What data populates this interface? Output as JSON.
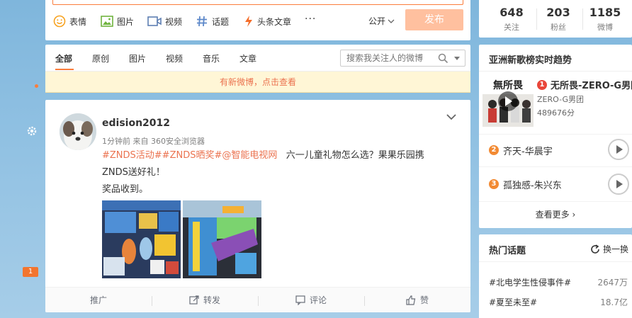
{
  "composer": {
    "tools": {
      "emoji": "表情",
      "picture": "图片",
      "video": "视频",
      "topic": "话题",
      "article": "头条文章",
      "more": "···"
    },
    "visibility": "公开",
    "publish_label": "发布",
    "accent_color": "#fa7d3c"
  },
  "feed_filters": {
    "tabs": [
      "全部",
      "原创",
      "图片",
      "视频",
      "音乐",
      "文章"
    ],
    "active_tab": "全部",
    "search_placeholder": "搜索我关注人的微博"
  },
  "notice": "有新微博，点击查看",
  "left_rail": {
    "badge_count": "1"
  },
  "post": {
    "author": "edision2012",
    "meta": "1分钟前 来自 360安全浏览器",
    "tags": "#ZNDS活动##ZNDS晒奖#@智能电视网",
    "text_line1_rest": "六一儿童礼物怎么选？果果乐园携",
    "text_line2": "ZNDS送好礼！",
    "text_line3": "奖品收到。",
    "actions": {
      "promote": "推广",
      "repost": "转发",
      "comment": "评论",
      "like": "赞"
    }
  },
  "profile_stats": [
    {
      "num": "648",
      "label": "关注"
    },
    {
      "num": "203",
      "label": "粉丝"
    },
    {
      "num": "1185",
      "label": "微博"
    }
  ],
  "trending_music": {
    "title": "亚洲新歌榜实时趋势",
    "album_text": "無所畏",
    "top": {
      "rank": "1",
      "title": "无所畏-ZERO-G男团",
      "artist": "ZERO-G男团",
      "plays": "489676分"
    },
    "others": [
      {
        "rank": "2",
        "title": "齐天-华晨宇"
      },
      {
        "rank": "3",
        "title": "孤独感-朱兴东"
      }
    ],
    "see_more": "查看更多"
  },
  "hot_topics": {
    "title": "热门话题",
    "refresh_label": "换一换",
    "items": [
      {
        "name": "#北电学生性侵事件#",
        "count": "2647万"
      },
      {
        "name": "#夏至未至#",
        "count": "18.7亿"
      }
    ]
  }
}
